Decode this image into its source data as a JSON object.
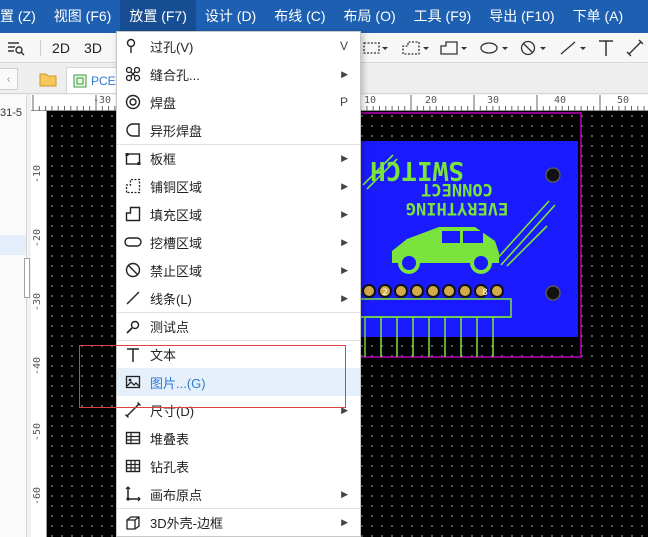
{
  "menubar": {
    "items": [
      {
        "label": "置 (Z)"
      },
      {
        "label": "视图 (F6)"
      },
      {
        "label": "放置 (F7)"
      },
      {
        "label": "设计 (D)"
      },
      {
        "label": "布线 (C)"
      },
      {
        "label": "布局 (O)"
      },
      {
        "label": "工具 (F9)"
      },
      {
        "label": "导出 (F10)"
      },
      {
        "label": "下单 (A)"
      }
    ]
  },
  "toolbar": {
    "btn_2d": "2D",
    "btn_3d": "3D"
  },
  "tabs": {
    "pcb_tab_label": "PCE",
    "side_fragment": "31-5"
  },
  "ruler": {
    "top": [
      "-30",
      "10",
      "20",
      "30",
      "40",
      "50"
    ],
    "left": [
      "-10",
      "-20",
      "-30",
      "-40",
      "-50",
      "-60"
    ]
  },
  "pcb": {
    "text_line1": "SWITCH",
    "text_line2": "CONNECT",
    "text_line3": "EVERYTHING",
    "pad_labels": [
      "2",
      "8"
    ],
    "colors": {
      "board": "#1a1aff",
      "silk": "#7be33d",
      "outline": "#c000c0",
      "background": "#000000"
    }
  },
  "dropdown": {
    "items": [
      {
        "label": "过孔(V)",
        "shortcut": "V",
        "icon": "via-icon"
      },
      {
        "label": "缝合孔...",
        "submenu": true,
        "icon": "stitching-via-icon"
      },
      {
        "label": "焊盘",
        "shortcut": "P",
        "icon": "pad-icon"
      },
      {
        "label": "异形焊盘",
        "icon": "custom-pad-icon"
      },
      {
        "label": "板框",
        "submenu": true,
        "icon": "board-outline-icon"
      },
      {
        "label": "铺铜区域",
        "submenu": true,
        "icon": "copper-area-icon"
      },
      {
        "label": "填充区域",
        "submenu": true,
        "icon": "fill-area-icon"
      },
      {
        "label": "挖槽区域",
        "submenu": true,
        "icon": "slot-area-icon"
      },
      {
        "label": "禁止区域",
        "submenu": true,
        "icon": "keepout-area-icon"
      },
      {
        "label": "线条(L)",
        "submenu": true,
        "icon": "line-icon"
      },
      {
        "label": "测试点",
        "icon": "test-point-icon"
      },
      {
        "label": "文本",
        "icon": "text-icon"
      },
      {
        "label": "图片...(G)",
        "icon": "image-icon"
      },
      {
        "label": "尺寸(D)",
        "submenu": true,
        "icon": "dimension-icon"
      },
      {
        "label": "堆叠表",
        "icon": "stackup-table-icon"
      },
      {
        "label": "钻孔表",
        "icon": "drill-table-icon"
      },
      {
        "label": "画布原点",
        "submenu": true,
        "icon": "canvas-origin-icon"
      },
      {
        "label": "3D外壳-边框",
        "submenu": true,
        "icon": "3d-shell-icon"
      }
    ],
    "submenu_arrow": "▶",
    "highlighted_index": 12
  }
}
